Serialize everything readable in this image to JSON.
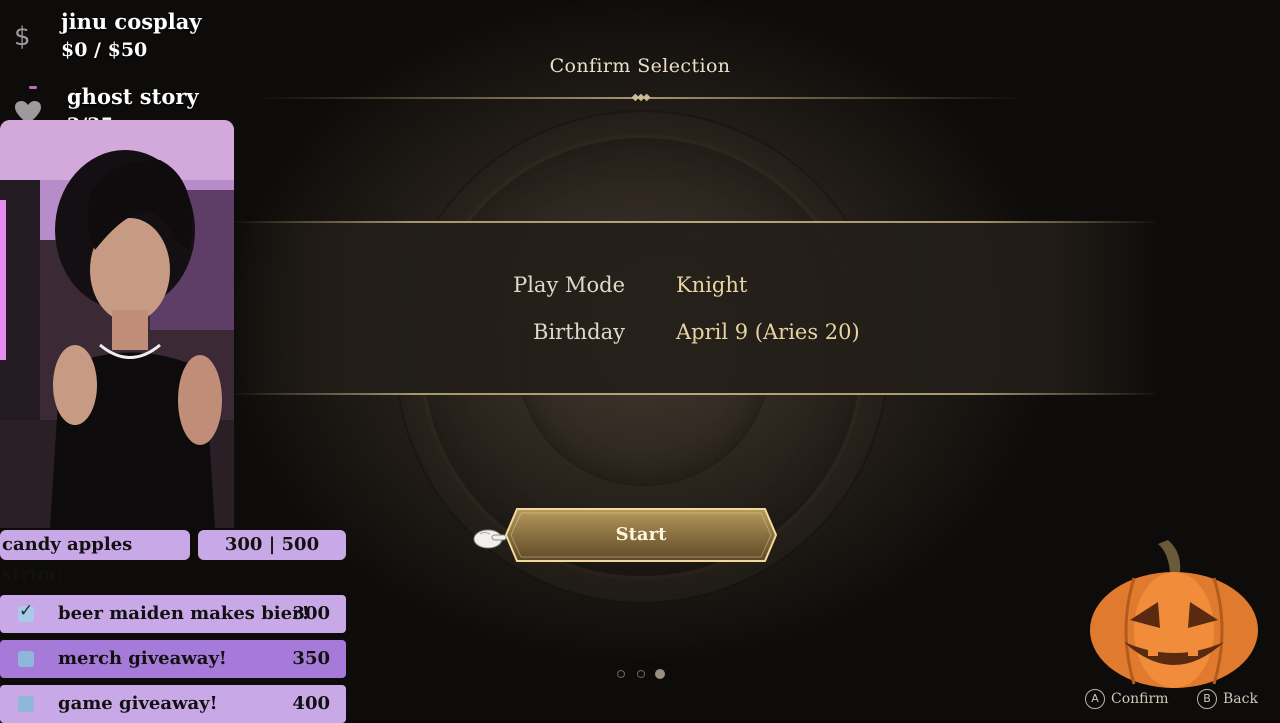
{
  "screen": {
    "title": "Confirm Selection",
    "details": [
      {
        "label": "Play Mode",
        "value": "Knight"
      },
      {
        "label": "Birthday",
        "value": "April 9 (Aries 20)"
      }
    ],
    "start_label": "Start",
    "page_dots": {
      "count": 3,
      "active_index": 2
    },
    "hints": [
      {
        "key": "A",
        "label": "Confirm"
      },
      {
        "key": "B",
        "label": "Back"
      }
    ]
  },
  "overlay": {
    "donation_goal": {
      "icon": "dollar-icon",
      "title": "jinu cosplay",
      "progress": "$0 / $50"
    },
    "follower_goal": {
      "icon": "heart-icon",
      "title": "ghost story",
      "progress": "2/35"
    },
    "sub_goal": {
      "title": "candy apples strim!",
      "progress": "300 | 500"
    },
    "goals": [
      {
        "label": "beer maiden makes bier!",
        "amount": "300",
        "done": true
      },
      {
        "label": "merch giveaway!",
        "amount": "350",
        "done": false
      },
      {
        "label": "game giveaway!",
        "amount": "400",
        "done": false
      }
    ],
    "colors": {
      "pill": "#c9a8e8",
      "row_done": "#c9a8e8",
      "row_active": "#a67ad8",
      "checkbox": "#8fb7d9"
    }
  }
}
